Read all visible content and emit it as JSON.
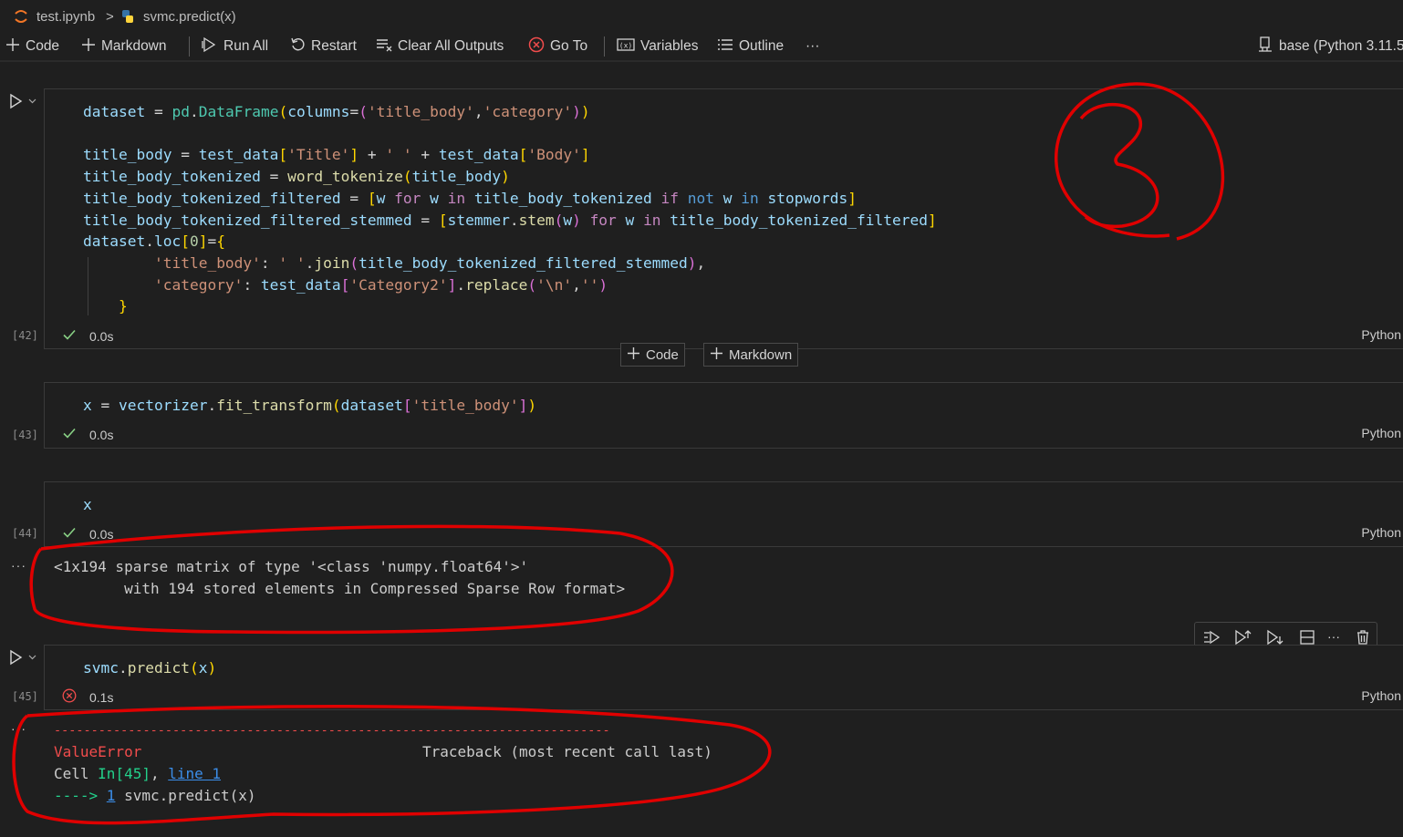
{
  "breadcrumb": {
    "file": "test.ipynb",
    "separator": ">",
    "symbol": "svmc.predict(x)"
  },
  "toolbar": {
    "code": "Code",
    "markdown": "Markdown",
    "run_all": "Run All",
    "restart": "Restart",
    "clear_all_outputs": "Clear All Outputs",
    "go_to": "Go To",
    "variables": "Variables",
    "outline": "Outline",
    "more": "···",
    "kernel": "base (Python 3.11.5)"
  },
  "cells": [
    {
      "exec_count": "[42]",
      "status_time": "0.0s",
      "status": "success",
      "language": "Python"
    },
    {
      "exec_count": "[43]",
      "status_time": "0.0s",
      "status": "success",
      "language": "Python"
    },
    {
      "exec_count": "[44]",
      "status_time": "0.0s",
      "status": "success",
      "language": "Python",
      "output_dots": "···",
      "output": [
        "<1x194 sparse matrix of type '<class 'numpy.float64'>'",
        "\twith 194 stored elements in Compressed Sparse Row format>"
      ]
    },
    {
      "exec_count": "[45]",
      "status_time": "0.1s",
      "status": "error",
      "language": "Python",
      "output_dots": "···",
      "error": {
        "rule": "---------------------------------------------------------------------------",
        "name": "ValueError",
        "traceback_label": "Traceback (most recent call last)",
        "cell_prefix": "Cell ",
        "cell_ref": "In[45]",
        "comma": ", ",
        "line_ref": "line 1",
        "arrow": "----> ",
        "line_no": "1",
        "code": " svmc.predict(x)"
      }
    }
  ],
  "add_cell": {
    "code": "Code",
    "markdown": "Markdown"
  },
  "annotation": {
    "label": "3"
  },
  "colors": {
    "accent_red": "#e00000",
    "success_green": "#89d185",
    "error_red": "#f14c4c"
  }
}
